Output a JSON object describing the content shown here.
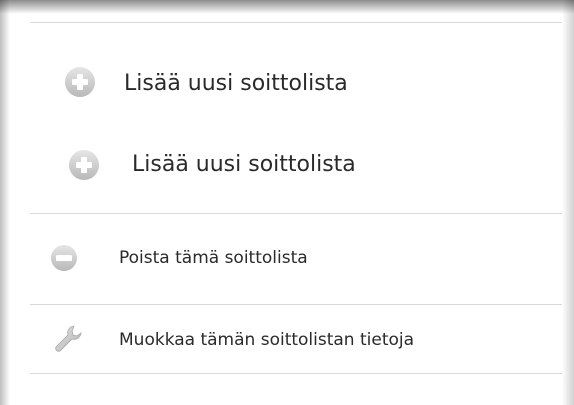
{
  "menu": {
    "items": [
      {
        "label": "Lisää uusi soittolista",
        "icon": "plus-circle-icon"
      },
      {
        "label": "Lisää uusi soittolista",
        "icon": "plus-circle-icon"
      },
      {
        "label": "Poista tämä soittolista",
        "icon": "minus-circle-icon"
      },
      {
        "label": "Muokkaa tämän soittolistan tietoja",
        "icon": "wrench-icon"
      }
    ]
  },
  "colors": {
    "icon_fill": "#c9c9c9",
    "text": "#2a2a2a",
    "divider": "#d9d9d9"
  }
}
